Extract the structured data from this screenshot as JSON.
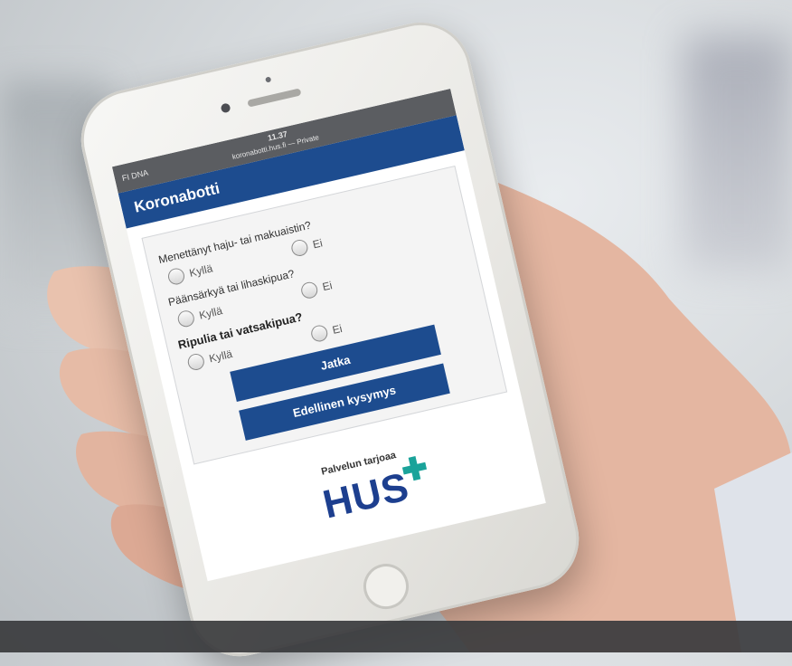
{
  "photo": {
    "description": ""
  },
  "status_bar": {
    "carrier": "FI DNA",
    "time": "11.37",
    "url": "koronabotti.hus.fi — Private"
  },
  "app": {
    "title": "Koronabotti"
  },
  "questions": [
    {
      "label": "Menettänyt haju- tai makuaistin?",
      "yes": "Kyllä",
      "no": "Ei"
    },
    {
      "label": "Päänsärkyä tai lihaskipua?",
      "yes": "Kyllä",
      "no": "Ei"
    },
    {
      "label": "Ripulia tai vatsakipua?",
      "yes": "Kyllä",
      "no": "Ei"
    }
  ],
  "buttons": {
    "continue": "Jatka",
    "previous": "Edellinen kysymys"
  },
  "footer": {
    "provider": "Palvelun tarjoaa",
    "logo": "HUS"
  }
}
